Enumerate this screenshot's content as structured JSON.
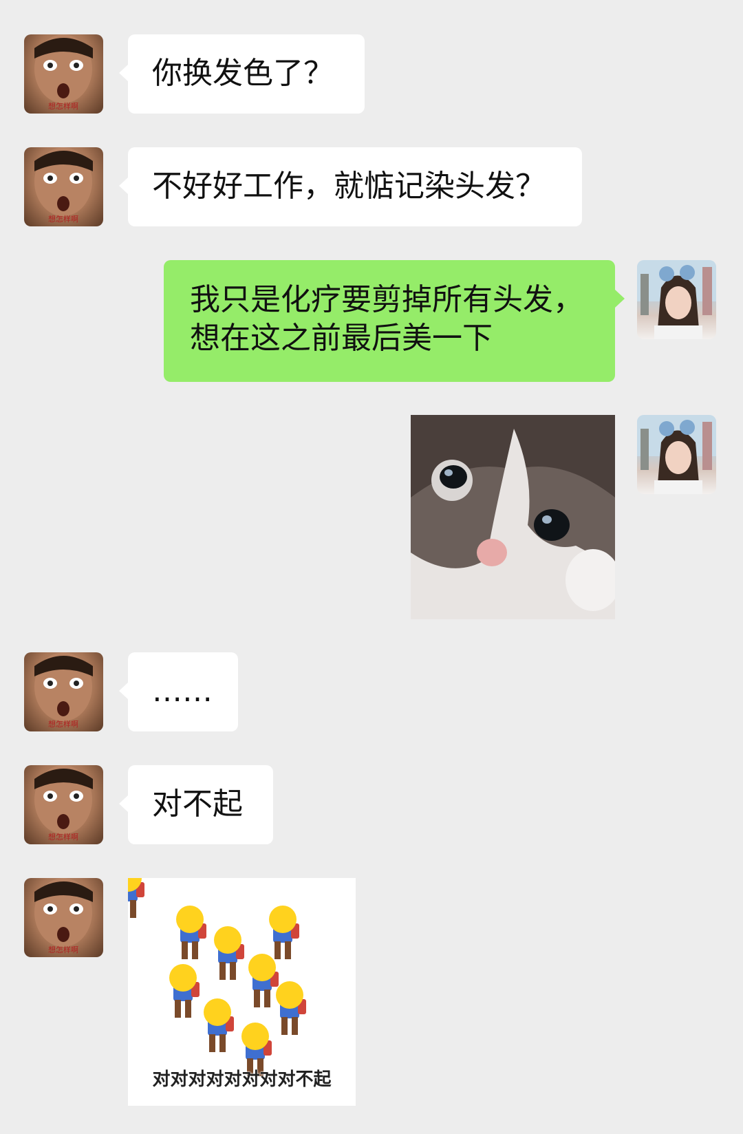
{
  "messages": [
    {
      "side": "left",
      "type": "text",
      "text": "你换发色了？"
    },
    {
      "side": "left",
      "type": "text",
      "text": "不好好工作，就惦记染头发？"
    },
    {
      "side": "right",
      "type": "text",
      "line1": "我只是化疗要剪掉所有头发，",
      "line2": "想在这之前最后美一下"
    },
    {
      "side": "right",
      "type": "image",
      "icon": "crying-cat-image"
    },
    {
      "side": "left",
      "type": "text",
      "text": "……"
    },
    {
      "side": "left",
      "type": "text",
      "text": "对不起"
    },
    {
      "side": "left",
      "type": "image",
      "icon": "bowing-emoji-sticker",
      "caption": "对对对对对对对对不起"
    }
  ],
  "avatars": {
    "man_caption": "想怎样啊"
  },
  "colors": {
    "background": "#ededed",
    "left_bubble": "#ffffff",
    "right_bubble": "#95ec69"
  }
}
